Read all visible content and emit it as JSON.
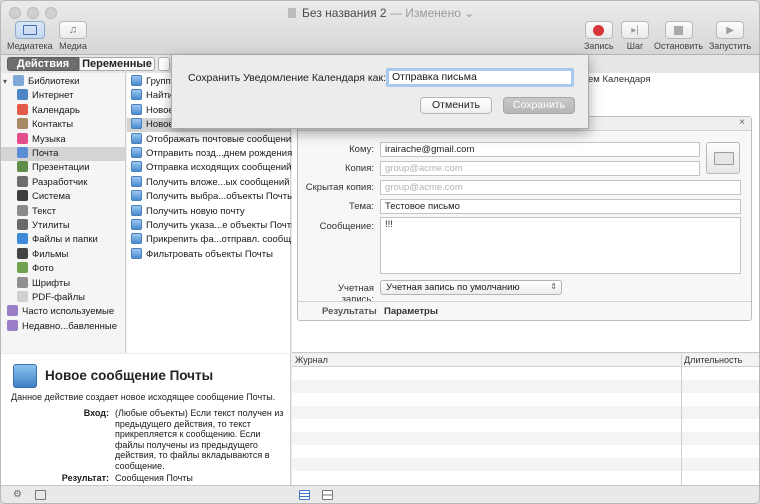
{
  "window": {
    "title": "Без названия 2",
    "title_suffix": "— Изменено ⌄"
  },
  "toolbar": {
    "library_label": "Медиатека",
    "media_label": "Медиа",
    "record_label": "Запись",
    "step_label": "Шаг",
    "stop_label": "Остановить",
    "run_label": "Запустить",
    "record_color": "#d6353a"
  },
  "segments": {
    "actions": "Действия",
    "variables": "Переменные"
  },
  "library": {
    "items": [
      {
        "label": "Библиотеки",
        "icon": "folder-icon",
        "color": "#7fa7d8"
      },
      {
        "label": "Интернет",
        "icon": "globe-icon",
        "color": "#4d86c4"
      },
      {
        "label": "Календарь",
        "icon": "calendar-icon",
        "color": "#e35c4b"
      },
      {
        "label": "Контакты",
        "icon": "contacts-icon",
        "color": "#a88b65"
      },
      {
        "label": "Музыка",
        "icon": "music-icon",
        "color": "#e24f8c"
      },
      {
        "label": "Почта",
        "icon": "mail-icon",
        "color": "#5b8ed6"
      },
      {
        "label": "Презентации",
        "icon": "presentation-icon",
        "color": "#5f8d4a"
      },
      {
        "label": "Разработчик",
        "icon": "tools-icon",
        "color": "#6e6e6e"
      },
      {
        "label": "Система",
        "icon": "system-icon",
        "color": "#3f3f3f"
      },
      {
        "label": "Текст",
        "icon": "text-icon",
        "color": "#8a8a8a"
      },
      {
        "label": "Утилиты",
        "icon": "utilities-icon",
        "color": "#6a6a6a"
      },
      {
        "label": "Файлы и папки",
        "icon": "finder-icon",
        "color": "#3d8ad8"
      },
      {
        "label": "Фильмы",
        "icon": "film-icon",
        "color": "#444444"
      },
      {
        "label": "Фото",
        "icon": "photo-icon",
        "color": "#6fa24f"
      },
      {
        "label": "Шрифты",
        "icon": "font-icon",
        "color": "#8f8f8f"
      },
      {
        "label": "PDF-файлы",
        "icon": "pdf-icon",
        "color": "#d0d0d0"
      },
      {
        "label": "Часто используемые",
        "icon": "smart-folder-icon",
        "color": "#9a7fc8"
      },
      {
        "label": "Недавно...бавленные",
        "icon": "smart-folder-icon",
        "color": "#9a7fc8"
      }
    ]
  },
  "actions": {
    "items": [
      "Групп",
      "Найти",
      "Новое",
      "Новое",
      "Отображать почтовые сообщения",
      "Отправить позд...днем рождения",
      "Отправка исходящих сообщений",
      "Получить вложе...ых сообщений",
      "Получить выбра...объекты Почты",
      "Получить новую почту",
      "Получить указа...е объекты Почты",
      "Прикрепить фа...отправл. сообщ.",
      "Фильтровать объекты Почты"
    ]
  },
  "workflow": {
    "calendar_fragment": "ем Календаря",
    "fields": {
      "to_label": "Кому:",
      "to_value": "irairache@gmail.com",
      "cc_label": "Копия:",
      "cc_placeholder": "group@acme.com",
      "bcc_label": "Скрытая копия:",
      "bcc_placeholder": "group@acme.com",
      "subject_label": "Тема:",
      "subject_value": "Тестовое письмо",
      "message_label": "Сообщение:",
      "message_value": "!!!",
      "account_label": "Учетная запись:",
      "account_value": "Учетная запись по умолчанию"
    },
    "tabs": {
      "results": "Результаты",
      "params": "Параметры"
    }
  },
  "log": {
    "journal": "Журнал",
    "duration": "Длительность"
  },
  "description": {
    "title": "Новое сообщение Почты",
    "summary": "Данное действие создает новое исходящее сообщение Почты.",
    "input_key": "Вход:",
    "input_value": "(Любые объекты) Если текст получен из предыдущего действия, то текст прикрепляется к сообщению. Если файлы получены из предыдущего действия, то файлы вкладываются в сообщение.",
    "result_key": "Результат:",
    "result_value": "Сообщения Почты"
  },
  "sheet": {
    "label": "Сохранить Уведомление Календаря как:",
    "value": "Отправка письма",
    "cancel": "Отменить",
    "save": "Сохранить"
  }
}
